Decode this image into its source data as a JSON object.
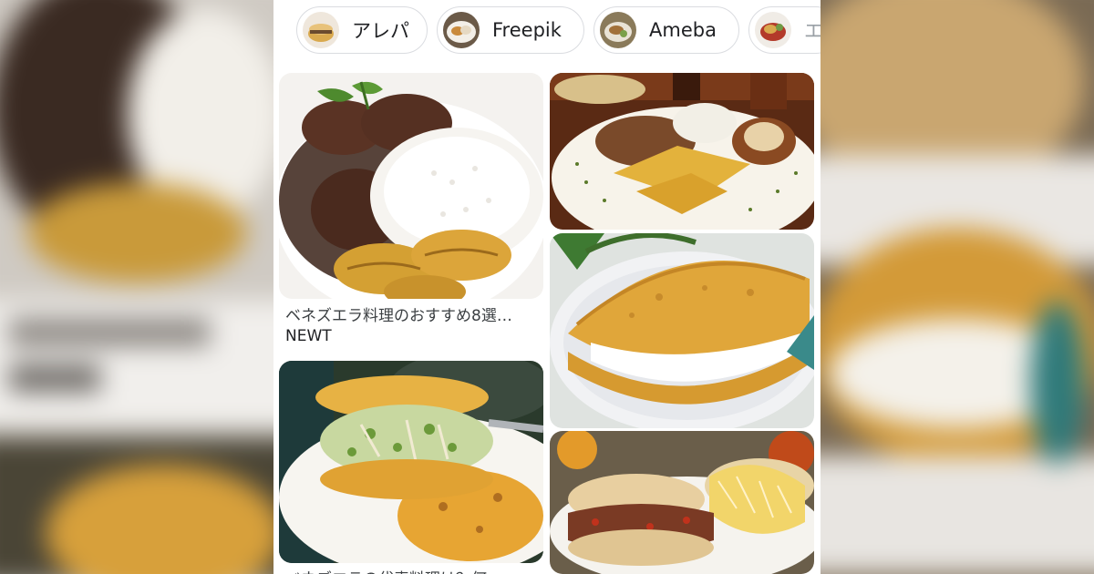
{
  "chips": [
    {
      "label": "アレパ",
      "thumb_icon": "arepa-thumbnail"
    },
    {
      "label": "Freepik",
      "thumb_icon": "plate-thumbnail"
    },
    {
      "label": "Ameba",
      "thumb_icon": "dish-thumbnail"
    },
    {
      "label": "エ",
      "thumb_icon": "food-thumbnail"
    }
  ],
  "results": [
    {
      "title": "ベネズエラ料理のおすすめ8選…",
      "source": "NEWT",
      "image": "pabellon-criollo-plate"
    },
    {
      "title": "",
      "source": "",
      "image": "hallaca-plate"
    },
    {
      "title": "",
      "source": "",
      "image": "cachapa-with-cheese"
    },
    {
      "title": "",
      "source": "",
      "image": "arepas-filled"
    },
    {
      "title": "ベネズエラの代表料理は？何…",
      "source": "",
      "image": "reina-pepiada-arepas"
    }
  ],
  "colors": {
    "chip_border": "#dadce0",
    "text": "#202124",
    "background": "#ffffff"
  }
}
